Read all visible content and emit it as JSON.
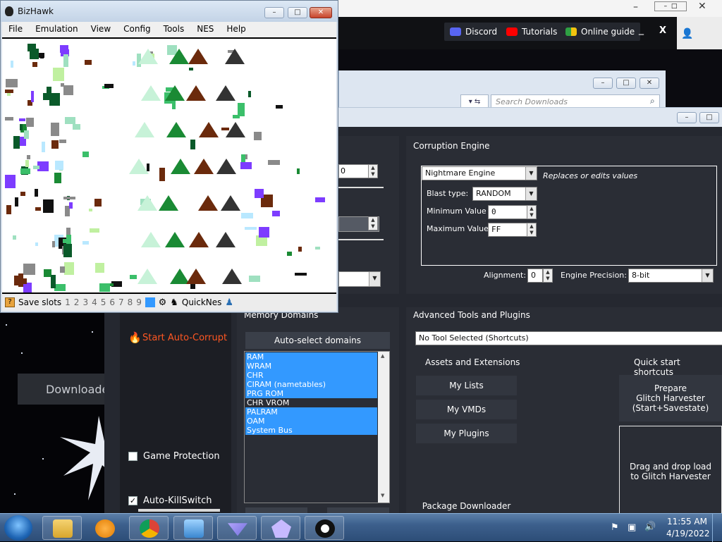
{
  "bizhawk": {
    "title": "BizHawk",
    "menu": [
      "File",
      "Emulation",
      "View",
      "Config",
      "Tools",
      "NES",
      "Help"
    ],
    "status": {
      "save_slots_label": "Save slots",
      "slots": [
        "1",
        "2",
        "3",
        "4",
        "5",
        "6",
        "7",
        "8",
        "9",
        "0"
      ],
      "active_slot": "0",
      "core": "QuickNes"
    },
    "title_buttons": [
      "–",
      "□",
      "✕"
    ]
  },
  "launcher": {
    "buttons": [
      "Discord",
      "Tutorials",
      "Online guide"
    ],
    "minimize": "_",
    "close": "X",
    "title_buttons": [
      "–",
      "□",
      "✕"
    ]
  },
  "downloads": {
    "search_placeholder": "Search Downloads"
  },
  "rtc": {
    "corruption_engine": {
      "title": "Corruption Engine",
      "engine": "Nightmare Engine",
      "engine_desc": "Replaces or edits values",
      "blast_type_label": "Blast type:",
      "blast_type": "RANDOM",
      "min_label": "Minimum Value",
      "min_value": "0",
      "max_label": "Maximum Value",
      "max_value": "FF",
      "alignment_label": "Alignment:",
      "alignment_value": "0",
      "precision_label": "Engine Precision:",
      "precision_value": "8-bit"
    },
    "memory_domains": {
      "title": "Memory Domains",
      "auto_select": "Auto-select domains",
      "items": [
        {
          "label": "RAM",
          "selected": true
        },
        {
          "label": "WRAM",
          "selected": true
        },
        {
          "label": "CHR",
          "selected": true
        },
        {
          "label": "CIRAM (nametables)",
          "selected": true
        },
        {
          "label": "PRG ROM",
          "selected": true
        },
        {
          "label": "CHR VROM",
          "selected": false
        },
        {
          "label": "PALRAM",
          "selected": true
        },
        {
          "label": "OAM",
          "selected": true
        },
        {
          "label": "System Bus",
          "selected": true
        }
      ]
    },
    "left": {
      "start_auto_corrupt": "Start Auto-Corrupt",
      "game_protection": "Game Protection",
      "game_protection_checked": false,
      "auto_killswitch": "Auto-KillSwitch",
      "auto_killswitch_checked": true
    },
    "advanced": {
      "title": "Advanced Tools and Plugins",
      "tool_select": "No Tool Selected (Shortcuts)",
      "assets_title": "Assets and Extensions",
      "quick_title": "Quick start shortcuts",
      "my_lists": "My Lists",
      "my_vmds": "My VMDs",
      "my_plugins": "My Plugins",
      "package_downloader": "Package Downloader",
      "prepare_line1": "Prepare",
      "prepare_line2": "Glitch Harvester",
      "prepare_line3": "(Start+Savestate)",
      "drag_line1": "Drag and drop load",
      "drag_line2": "to Glitch Harvester"
    },
    "downloads_label": "Downloade"
  },
  "taskbar": {
    "time": "11:55 AM",
    "date": "4/19/2022",
    "apps": [
      "start-orb",
      "file-explorer",
      "media-player",
      "chrome",
      "control-panel",
      "rtc-launcher",
      "rtc-glitch",
      "incognito-app"
    ]
  },
  "colors": {
    "rtc_bg": "#252830",
    "rtc_panel": "#2a2d35",
    "selection": "#3399ff",
    "auto_corrupt": "#ff5722",
    "taskbar": "#3c5f8c"
  }
}
